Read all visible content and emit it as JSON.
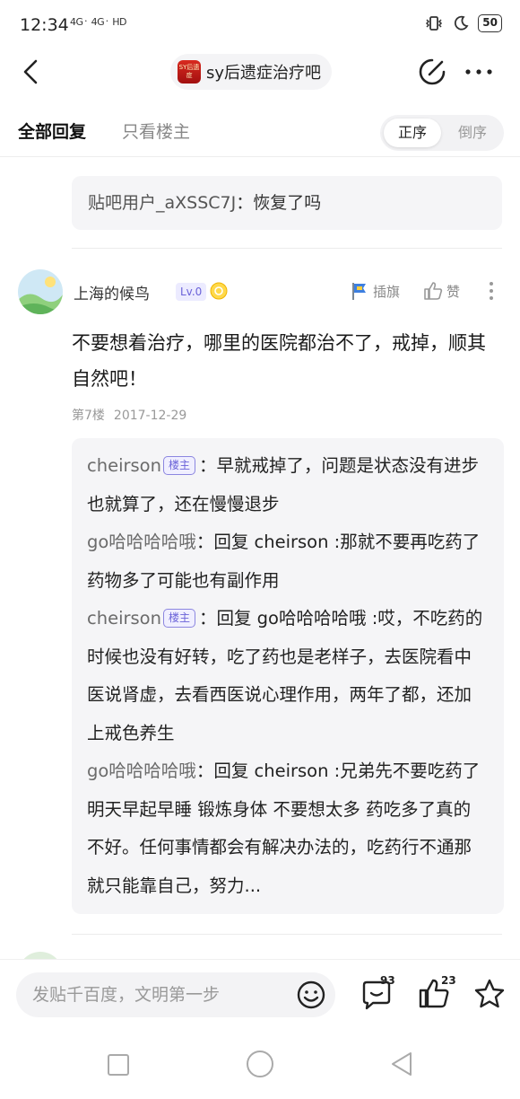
{
  "status_bar": {
    "time": "12:34",
    "signal": "4G᛫ 4G᛫ HD",
    "battery": "50"
  },
  "header": {
    "forum_logo_text": "SY后遗症",
    "forum_name": "sy后遗症治疗吧"
  },
  "tabs": {
    "all_replies": "全部回复",
    "owner_only": "只看楼主",
    "order_asc": "正序",
    "order_desc": "倒序"
  },
  "previous_reply": {
    "user": "贴吧用户_aXSSC7J",
    "separator": "：",
    "text": "恢复了吗"
  },
  "post": {
    "username": "上海的候鸟",
    "level": "Lv.0",
    "flag_label": "插旗",
    "like_label": "赞",
    "content": "不要想着治疗，哪里的医院都治不了，戒掉，顺其自然吧！",
    "floor": "第7楼",
    "date": "2017-12-29",
    "owner_tag": "楼主",
    "replies": [
      {
        "user": "cheirson",
        "owner": true,
        "text": "：早就戒掉了，问题是状态没有进步也就算了，还在慢慢退步"
      },
      {
        "user": "go哈哈哈哈哦",
        "owner": false,
        "text": "：回复 cheirson :那就不要再吃药了 药物多了可能也有副作用"
      },
      {
        "user": "cheirson",
        "owner": true,
        "text": "：回复 go哈哈哈哈哦 :哎，不吃药的时候也没有好转，吃了药也是老样子，去医院看中医说肾虚，去看西医说心理作用，两年了都，还加上戒色养生"
      },
      {
        "user": "go哈哈哈哈哦",
        "owner": false,
        "text": "：回复 cheirson :兄弟先不要吃药了 明天早起早睡 锻炼身体 不要想太多 药吃多了真的不好。任何事情都会有解决办法的，吃药行不通那就只能靠自己，努力..."
      }
    ]
  },
  "bottom_bar": {
    "input_placeholder": "发贴千百度，文明第一步",
    "comment_count": "93",
    "like_count": "23"
  },
  "colors": {
    "accent_purple": "#6a62d8",
    "quote_bg": "#f5f5f7",
    "muted_text": "#999999"
  }
}
